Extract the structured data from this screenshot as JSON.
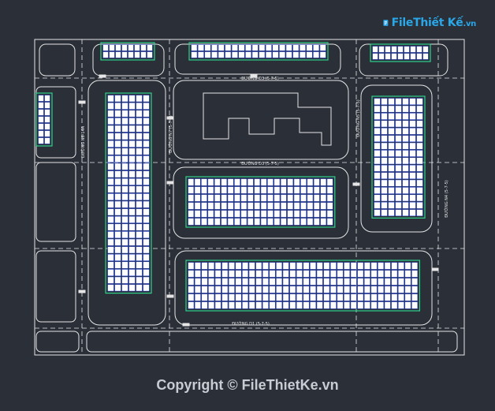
{
  "watermark_logo": {
    "brand": "File",
    "brand_rest": "Thiết Kế",
    "tld": ".vn"
  },
  "copyright": "Copyright © FileThietKe.vn",
  "street_labels": {
    "top": "ĐƯỜNG D3 (5-7-5)",
    "middle": "ĐƯỜNG D3 (5-7-5)",
    "bottom": "ĐƯỜNG D1 (5-7-5)",
    "left": "ĐƯỜNG N6-14A",
    "left_inner": "ĐƯỜNG N7 (5-7-5)",
    "right": "ĐƯỜNG N4 (5-7-5)",
    "right_inner": "ĐƯỜNG N5 (5-7-5)"
  },
  "colors": {
    "background": "#2a2f38",
    "road_line": "#e6e6e6",
    "lot_fill": "#ffffff",
    "boundary": "#2fd18c",
    "lot_outline": "#1e3fd6",
    "accent": "#2aa7e8"
  }
}
